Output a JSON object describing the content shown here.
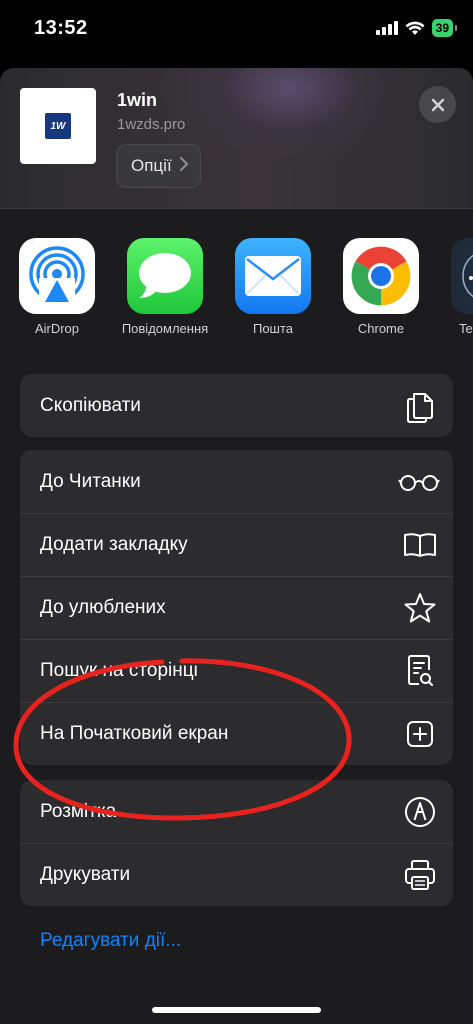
{
  "status_bar": {
    "time": "13:52",
    "battery": "39"
  },
  "share_header": {
    "title": "1win",
    "url": "1wzds.pro",
    "options_label": "Опції",
    "logo_text": "1W"
  },
  "apps": [
    {
      "name": "airdrop",
      "label": "AirDrop"
    },
    {
      "name": "messages",
      "label": "Повідомлення"
    },
    {
      "name": "mail",
      "label": "Пошта"
    },
    {
      "name": "chrome",
      "label": "Chrome"
    },
    {
      "name": "partial",
      "label": "Te"
    }
  ],
  "actions": {
    "group1": [
      {
        "label": "Скопіювати",
        "icon": "copy-icon"
      }
    ],
    "group2": [
      {
        "label": "До Читанки",
        "icon": "reader-glasses-icon"
      },
      {
        "label": "Додати закладку",
        "icon": "book-icon"
      },
      {
        "label": "До улюблених",
        "icon": "star-icon"
      },
      {
        "label": "Пошук на сторінці",
        "icon": "find-on-page-icon"
      },
      {
        "label": "На Початковий екран",
        "icon": "add-square-icon"
      }
    ],
    "group3": [
      {
        "label": "Розмітка",
        "icon": "markup-icon"
      },
      {
        "label": "Друкувати",
        "icon": "printer-icon"
      }
    ]
  },
  "edit_actions_label": "Редагувати дії...",
  "colors": {
    "accent": "#0a84ff",
    "annotation": "#e8231f",
    "sheet": "#1c1c1e",
    "row": "#2c2c2e"
  }
}
